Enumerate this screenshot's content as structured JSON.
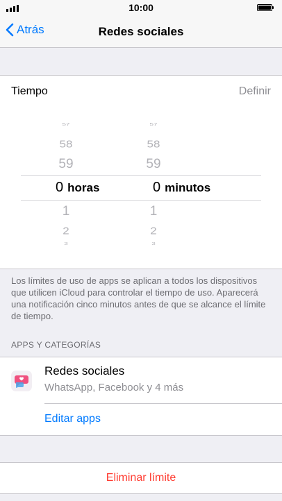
{
  "status": {
    "time": "10:00"
  },
  "nav": {
    "back_label": "Atrás",
    "title": "Redes sociales"
  },
  "time_row": {
    "label": "Tiempo",
    "action": "Definir"
  },
  "picker": {
    "hours": {
      "above": [
        "57",
        "58",
        "59"
      ],
      "selected": "0",
      "unit": "horas",
      "below": [
        "1",
        "2",
        "3"
      ]
    },
    "minutes": {
      "above": [
        "57",
        "58",
        "59"
      ],
      "selected": "0",
      "unit": "minutos",
      "below": [
        "1",
        "2",
        "3"
      ]
    }
  },
  "footer_text": "Los límites de uso de apps se aplican a todos los dispositivos que utilicen iCloud para controlar el tiempo de uso. Aparecerá una notificación cinco minutos antes de que se alcance el límite de tiempo.",
  "group_header": "APPS Y CATEGORÍAS",
  "category": {
    "icon": "social-networks-icon",
    "title": "Redes sociales",
    "subtitle": "WhatsApp, Facebook y 4 más",
    "edit_label": "Editar apps"
  },
  "delete_label": "Eliminar límite",
  "colors": {
    "accent": "#007aff",
    "destructive": "#ff3b30",
    "secondary_text": "#8e8e93",
    "background": "#efeff4"
  }
}
